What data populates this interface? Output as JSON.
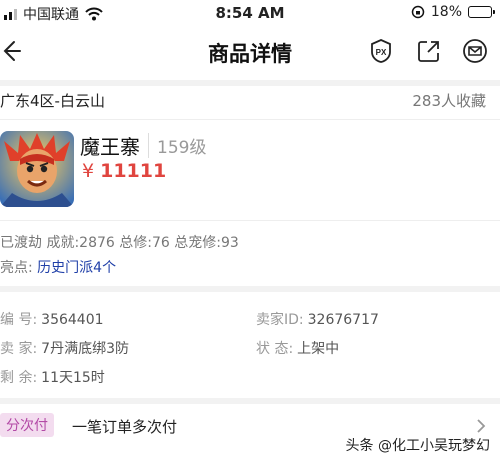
{
  "status_bar": {
    "carrier": "中国联通",
    "time": "8:54 AM",
    "battery_percent": "18%",
    "battery_level": 0.18,
    "battery_color": "#e53935"
  },
  "header": {
    "title": "商品详情",
    "icons": [
      "back-arrow-icon",
      "px-badge-icon",
      "share-icon",
      "mail-icon"
    ],
    "px_label": "PX"
  },
  "listing": {
    "region": "广东4区-白云山",
    "favorites": "283人收藏",
    "character_name": "魔王寨",
    "level": "159级",
    "price_symbol": "¥",
    "price": "11111",
    "stats_line": "已渡劫 成就:2876 总修:76 总宠修:93",
    "highlight_label": "亮点:",
    "highlight_value": "历史门派4个"
  },
  "details": {
    "id_label": "编 号:",
    "id_value": "3564401",
    "seller_id_label": "卖家ID:",
    "seller_id_value": "32676717",
    "seller_label": "卖 家:",
    "seller_value": "7丹满底绑3防",
    "state_label": "状 态:",
    "state_value": "上架中",
    "remaining_label": "剩 余:",
    "remaining_value": "11天15时"
  },
  "payment": {
    "tag": "分次付",
    "description": "一笔订单多次付"
  },
  "watermark": "头条 @化工小吴玩梦幻",
  "colors": {
    "price": "#e0453f",
    "highlight_link": "#1f3fa8",
    "tag_bg": "#f3dcef",
    "tag_text": "#b34aa6"
  }
}
